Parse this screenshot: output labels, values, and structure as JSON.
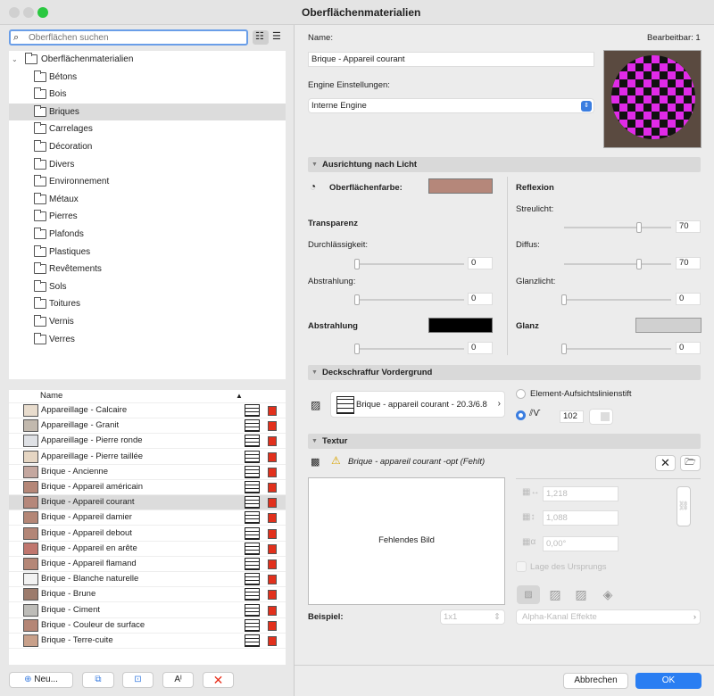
{
  "window": {
    "title": "Oberflächenmaterialien"
  },
  "search": {
    "placeholder": "Oberflächen suchen"
  },
  "tree": {
    "root": "Oberflächenmaterialien",
    "folders": [
      "Bétons",
      "Bois",
      "Briques",
      "Carrelages",
      "Décoration",
      "Divers",
      "Environnement",
      "Métaux",
      "Pierres",
      "Plafonds",
      "Plastiques",
      "Revêtements",
      "Sols",
      "Toitures",
      "Vernis",
      "Verres"
    ],
    "selected": 2
  },
  "list": {
    "header": "Name",
    "selected": 6,
    "rows": [
      {
        "name": "Appareillage - Calcaire",
        "color": "#e8dccd"
      },
      {
        "name": "Appareillage - Granit",
        "color": "#c2b9ae"
      },
      {
        "name": "Appareillage - Pierre ronde",
        "color": "#dfe1e5"
      },
      {
        "name": "Appareillage - Pierre taillée",
        "color": "#e6d6c3"
      },
      {
        "name": "Brique - Ancienne",
        "color": "#c4a79f"
      },
      {
        "name": "Brique - Appareil américain",
        "color": "#b58778"
      },
      {
        "name": "Brique - Appareil courant",
        "color": "#b5877a"
      },
      {
        "name": "Brique - Appareil damier",
        "color": "#b48676"
      },
      {
        "name": "Brique - Appareil debout",
        "color": "#b38677"
      },
      {
        "name": "Brique - Appareil en arête",
        "color": "#c0766e"
      },
      {
        "name": "Brique - Appareil flamand",
        "color": "#b58777"
      },
      {
        "name": "Brique - Blanche naturelle",
        "color": "#f2f2f2"
      },
      {
        "name": "Brique - Brune",
        "color": "#9c7b6c"
      },
      {
        "name": "Brique - Ciment",
        "color": "#bdbcb8"
      },
      {
        "name": "Brique - Couleur de surface",
        "color": "#b58676"
      },
      {
        "name": "Brique - Terre-cuite",
        "color": "#c8a08a"
      }
    ]
  },
  "buttons": {
    "new": "Neu...",
    "cancel": "Abbrechen",
    "ok": "OK"
  },
  "props": {
    "name_label": "Name:",
    "editable": "Bearbeitbar: 1",
    "name_value": "Brique - Appareil courant",
    "engine_label": "Engine Einstellungen:",
    "engine_value": "Interne Engine"
  },
  "light": {
    "section": "Ausrichtung nach Licht",
    "surface_color_label": "Oberflächenfarbe:",
    "surface_color": "#b5877a",
    "reflexion": "Reflexion",
    "streulicht": "Streulicht:",
    "streulicht_v": "70",
    "diffus": "Diffus:",
    "diffus_v": "70",
    "glanzlicht": "Glanzlicht:",
    "glanzlicht_v": "0",
    "transparenz": "Transparenz",
    "durch": "Durchlässigkeit:",
    "durch_v": "0",
    "abstr": "Abstrahlung:",
    "abstr_v": "0",
    "abstrahlung": "Abstrahlung",
    "abstrahlung_color": "#000000",
    "abstrahlung_v": "0",
    "glanz": "Glanz",
    "glanz_color": "#d0d0d0",
    "glanz_v": "0"
  },
  "hatch": {
    "section": "Deckschraffur Vordergrund",
    "pattern": "Brique - appareil courant - 20.3/6.8",
    "pen_option": "Element-Aufsichtslinienstift",
    "pen_value": "102"
  },
  "texture": {
    "section": "Textur",
    "name": "Brique - appareil courant -opt (Fehlt)",
    "missing": "Fehlendes Bild",
    "width": "1,218",
    "height": "1,088",
    "angle": "0,00°",
    "origin": "Lage des Ursprungs",
    "example_label": "Beispiel:",
    "example_value": "1x1",
    "alpha": "Alpha-Kanal Effekte"
  }
}
